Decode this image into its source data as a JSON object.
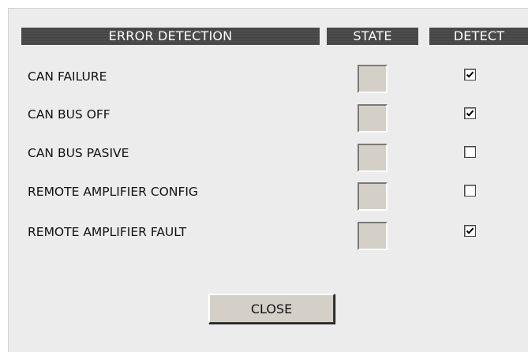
{
  "headers": {
    "error_detection": "ERROR DETECTION",
    "state": "STATE",
    "detect": "DETECT"
  },
  "rows": [
    {
      "label": "CAN FAILURE",
      "state": "",
      "detect": true
    },
    {
      "label": "CAN BUS OFF",
      "state": "",
      "detect": true
    },
    {
      "label": "CAN BUS PASIVE",
      "state": "",
      "detect": false
    },
    {
      "label": "REMOTE AMPLIFIER CONFIG",
      "state": "",
      "detect": false
    },
    {
      "label": "REMOTE AMPLIFIER FAULT",
      "state": "",
      "detect": true
    }
  ],
  "close_button": {
    "label": "CLOSE"
  },
  "colors": {
    "panel_bg": "#ececec",
    "header_bg": "#444444",
    "header_text": "#ffffff",
    "state_box": "#d4d0c8"
  }
}
